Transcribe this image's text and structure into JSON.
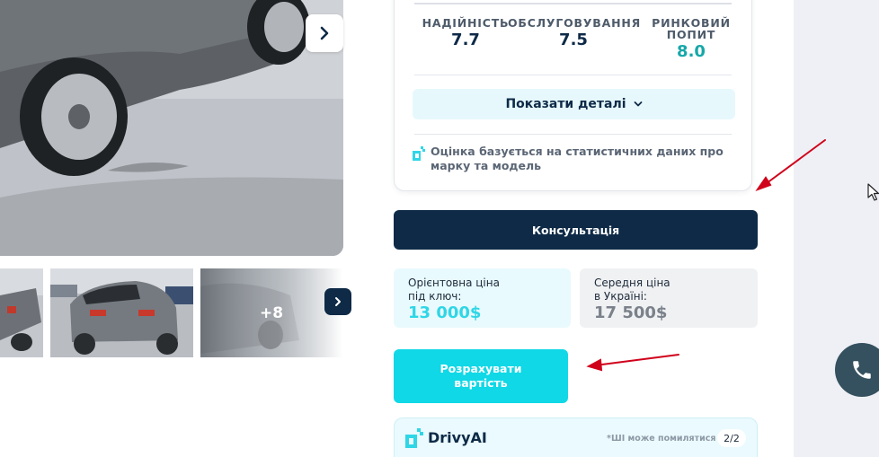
{
  "gallery": {
    "more_photos_label": "+8"
  },
  "score_card": {
    "metrics": [
      {
        "label": "НАДІЙНІСТЬ",
        "value": "7.7"
      },
      {
        "label": "ОБСЛУГОВУВАННЯ",
        "value": "7.5"
      },
      {
        "label_line1": "РИНКОВИЙ",
        "label_line2": "ПОПИТ",
        "value": "8.0"
      }
    ],
    "details_button": "Показати деталі",
    "note": "Оцінка базується на статистичних даних про марку та модель"
  },
  "consultation_button": "Консультація",
  "prices": {
    "estimated": {
      "label_line1": "Орієнтовна ціна",
      "label_line2": "під ключ:",
      "value": "13 000$"
    },
    "average": {
      "label_line1": "Середня ціна",
      "label_line2": "в Україні:",
      "value": "17 500$"
    }
  },
  "calculate_button": {
    "line1": "Розрахувати",
    "line2": "вартість"
  },
  "ai_panel": {
    "title": "DrivyAI",
    "warning": "*ШІ може помилятися",
    "counter": "2/2"
  },
  "colors": {
    "navy": "#0e2a47",
    "cyan": "#10d8e6",
    "teal_value": "#17a7a8",
    "annotation_red": "#d0021b"
  }
}
